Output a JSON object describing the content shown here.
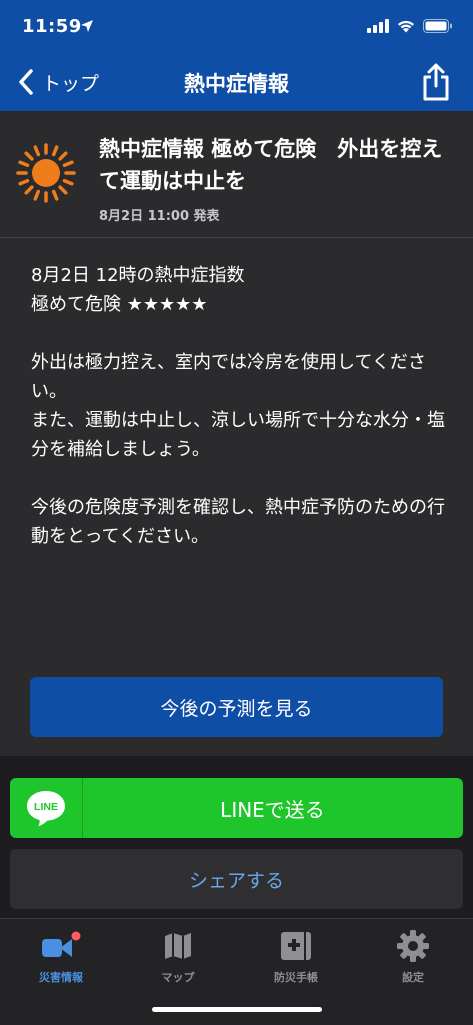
{
  "status_bar": {
    "time": "11:59"
  },
  "nav": {
    "back_label": "トップ",
    "title": "熱中症情報"
  },
  "alert": {
    "headline": "熱中症情報 極めて危険　外出を控えて運動は中止を",
    "issued": "8月2日 11:00 発表",
    "index_line": "8月2日 12時の熱中症指数",
    "level_line": "極めて危険 ★★★★★",
    "paragraph1": "外出は極力控え、室内では冷房を使用してください。",
    "paragraph2": "また、運動は中止し、涼しい場所で十分な水分・塩分を補給しましょう。",
    "paragraph3": "今後の危険度予測を確認し、熱中症予防のための行動をとってください。"
  },
  "buttons": {
    "forecast": "今後の予測を見る",
    "line_logo": "LINE",
    "line_send": "LINEで送る",
    "share": "シェアする"
  },
  "tabs": [
    {
      "label": "災害情報",
      "icon": "disaster-info-icon",
      "active": true
    },
    {
      "label": "マップ",
      "icon": "map-icon",
      "active": false
    },
    {
      "label": "防災手帳",
      "icon": "handbook-icon",
      "active": false
    },
    {
      "label": "設定",
      "icon": "gear-icon",
      "active": false
    }
  ],
  "colors": {
    "brand_blue": "#0f4ea6",
    "line_green": "#1fc62b",
    "sun_orange": "#f07d1c",
    "active_tab": "#4a90e2",
    "badge_red": "#ff5a5f"
  }
}
